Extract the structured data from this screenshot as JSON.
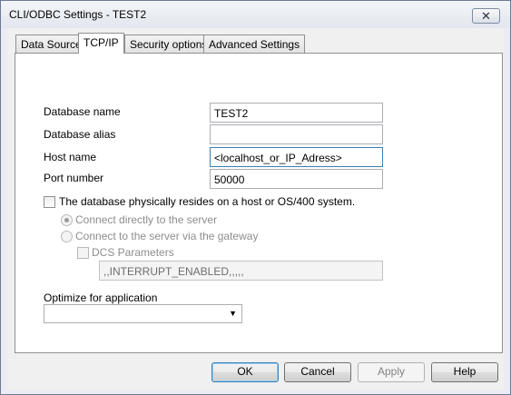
{
  "window": {
    "title": "CLI/ODBC Settings - TEST2",
    "close_glyph": "✕"
  },
  "tabs": [
    {
      "label": "Data Source"
    },
    {
      "label": "TCP/IP"
    },
    {
      "label": "Security options"
    },
    {
      "label": "Advanced Settings"
    }
  ],
  "form": {
    "database_name": {
      "label": "Database name",
      "value": "TEST2"
    },
    "database_alias": {
      "label": "Database alias",
      "value": ""
    },
    "host_name": {
      "label": "Host name",
      "value": "<localhost_or_IP_Adress>"
    },
    "port_number": {
      "label": "Port number",
      "value": "50000"
    },
    "host_check": {
      "label": "The database physically resides on a host or OS/400 system."
    },
    "radio_direct": {
      "label": "Connect directly to the server"
    },
    "radio_gateway": {
      "label": "Connect to the server via the gateway"
    },
    "dcs": {
      "label": "DCS Parameters",
      "value": ",,INTERRUPT_ENABLED,,,,,"
    },
    "optimize": {
      "label": "Optimize for application",
      "value": ""
    }
  },
  "buttons": {
    "ok": "OK",
    "cancel": "Cancel",
    "apply": "Apply",
    "help": "Help"
  }
}
